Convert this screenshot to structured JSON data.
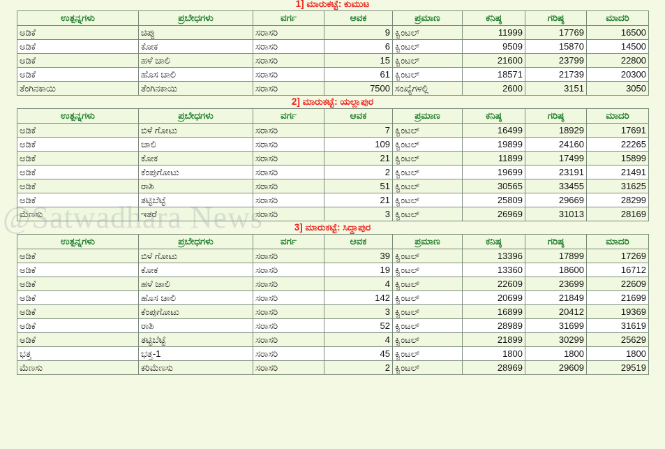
{
  "watermark": "@Satwadhara News",
  "columns": {
    "product": "ಉತ್ಪನ್ನಗಳು",
    "variety": "ಪ್ರಬೇಧಗಳು",
    "grade": "ವರ್ಗ",
    "arrival": "ಆವಕ",
    "unit": "ಪ್ರಮಾಣ",
    "min": "ಕನಿಷ್ಠ",
    "max": "ಗರಿಷ್ಠ",
    "modal": "ಮಾದರಿ"
  },
  "markets": [
    {
      "title": "1] ಮಾರುಕಟ್ಟೆ: ಕುಮುಟ",
      "rows": [
        {
          "product": "ಅಡಿಕೆ",
          "variety": "ಚಿಪ್ಪು",
          "grade": "ಸರಾಸರಿ",
          "arrival": "9",
          "unit": "ಕ್ವಿಂಟಲ್",
          "min": "11999",
          "max": "17769",
          "modal": "16500"
        },
        {
          "product": "ಅಡಿಕೆ",
          "variety": "ಕೋಕ",
          "grade": "ಸರಾಸರಿ",
          "arrival": "6",
          "unit": "ಕ್ವಿಂಟಲ್",
          "min": "9509",
          "max": "15870",
          "modal": "14500"
        },
        {
          "product": "ಅಡಿಕೆ",
          "variety": "ಹಳೆ ಚಾಲಿ",
          "grade": "ಸರಾಸರಿ",
          "arrival": "15",
          "unit": "ಕ್ವಿಂಟಲ್",
          "min": "21600",
          "max": "23799",
          "modal": "22800"
        },
        {
          "product": "ಅಡಿಕೆ",
          "variety": "ಹೊಸ ಚಾಲಿ",
          "grade": "ಸರಾಸರಿ",
          "arrival": "61",
          "unit": "ಕ್ವಿಂಟಲ್",
          "min": "18571",
          "max": "21739",
          "modal": "20300"
        },
        {
          "product": "ತೆಂಗಿನಕಾಯಿ",
          "variety": "ತೆಂಗಿನಕಾಯಿ",
          "grade": "ಸರಾಸರಿ",
          "arrival": "7500",
          "unit": "ಸಂಖ್ಯೆಗಳಲ್ಲಿ",
          "min": "2600",
          "max": "3151",
          "modal": "3050"
        }
      ]
    },
    {
      "title": "2] ಮಾರುಕಟ್ಟೆ: ಯಲ್ಲಾಪುರ",
      "rows": [
        {
          "product": "ಅಡಿಕೆ",
          "variety": "ಬಿಳೆ ಗೋಟು",
          "grade": "ಸರಾಸರಿ",
          "arrival": "7",
          "unit": "ಕ್ವಿಂಟಲ್",
          "min": "16499",
          "max": "18929",
          "modal": "17691"
        },
        {
          "product": "ಅಡಿಕೆ",
          "variety": "ಚಾಲಿ",
          "grade": "ಸರಾಸರಿ",
          "arrival": "109",
          "unit": "ಕ್ವಿಂಟಲ್",
          "min": "19899",
          "max": "24160",
          "modal": "22265"
        },
        {
          "product": "ಅಡಿಕೆ",
          "variety": "ಕೋಕ",
          "grade": "ಸರಾಸರಿ",
          "arrival": "21",
          "unit": "ಕ್ವಿಂಟಲ್",
          "min": "11899",
          "max": "17499",
          "modal": "15899"
        },
        {
          "product": "ಅಡಿಕೆ",
          "variety": "ಕೆಂಪುಗೋಟು",
          "grade": "ಸರಾಸರಿ",
          "arrival": "2",
          "unit": "ಕ್ವಿಂಟಲ್",
          "min": "19699",
          "max": "23191",
          "modal": "21491"
        },
        {
          "product": "ಅಡಿಕೆ",
          "variety": "ರಾಶಿ",
          "grade": "ಸರಾಸರಿ",
          "arrival": "51",
          "unit": "ಕ್ವಿಂಟಲ್",
          "min": "30565",
          "max": "33455",
          "modal": "31625"
        },
        {
          "product": "ಅಡಿಕೆ",
          "variety": "ತಟ್ಟಿಬೆಟ್ಟೆ",
          "grade": "ಸರಾಸರಿ",
          "arrival": "21",
          "unit": "ಕ್ವಿಂಟಲ್",
          "min": "25809",
          "max": "29669",
          "modal": "28299"
        },
        {
          "product": "ಮೆಣಸು",
          "variety": "ಇತರೆ",
          "grade": "ಸರಾಸರಿ",
          "arrival": "3",
          "unit": "ಕ್ವಿಂಟಲ್",
          "min": "26969",
          "max": "31013",
          "modal": "28169"
        }
      ]
    },
    {
      "title": "3] ಮಾರುಕಟ್ಟೆ: ಸಿದ್ದಾಪುರ",
      "rows": [
        {
          "product": "ಅಡಿಕೆ",
          "variety": "ಬಿಳೆ ಗೋಟು",
          "grade": "ಸರಾಸರಿ",
          "arrival": "39",
          "unit": "ಕ್ವಿಂಟಲ್",
          "min": "13396",
          "max": "17899",
          "modal": "17269"
        },
        {
          "product": "ಅಡಿಕೆ",
          "variety": "ಕೋಕ",
          "grade": "ಸರಾಸರಿ",
          "arrival": "19",
          "unit": "ಕ್ವಿಂಟಲ್",
          "min": "13360",
          "max": "18600",
          "modal": "16712"
        },
        {
          "product": "ಅಡಿಕೆ",
          "variety": "ಹಳೆ ಚಾಲಿ",
          "grade": "ಸರಾಸರಿ",
          "arrival": "4",
          "unit": "ಕ್ವಿಂಟಲ್",
          "min": "22609",
          "max": "23699",
          "modal": "22609"
        },
        {
          "product": "ಅಡಿಕೆ",
          "variety": "ಹೊಸ ಚಾಲಿ",
          "grade": "ಸರಾಸರಿ",
          "arrival": "142",
          "unit": "ಕ್ವಿಂಟಲ್",
          "min": "20699",
          "max": "21849",
          "modal": "21699"
        },
        {
          "product": "ಅಡಿಕೆ",
          "variety": "ಕೆಂಪುಗೋಟು",
          "grade": "ಸರಾಸರಿ",
          "arrival": "3",
          "unit": "ಕ್ವಿಂಟಲ್",
          "min": "16899",
          "max": "20412",
          "modal": "19369"
        },
        {
          "product": "ಅಡಿಕೆ",
          "variety": "ರಾಶಿ",
          "grade": "ಸರಾಸರಿ",
          "arrival": "52",
          "unit": "ಕ್ವಿಂಟಲ್",
          "min": "28989",
          "max": "31699",
          "modal": "31619"
        },
        {
          "product": "ಅಡಿಕೆ",
          "variety": "ತಟ್ಟಿಬೆಟ್ಟೆ",
          "grade": "ಸರಾಸರಿ",
          "arrival": "4",
          "unit": "ಕ್ವಿಂಟಲ್",
          "min": "21899",
          "max": "30299",
          "modal": "25629"
        },
        {
          "product": "ಭತ್ತ",
          "variety": "ಭತ್ತ-1",
          "grade": "ಸರಾಸರಿ",
          "arrival": "45",
          "unit": "ಕ್ವಿಂಟಲ್",
          "min": "1800",
          "max": "1800",
          "modal": "1800"
        },
        {
          "product": "ಮೆಣಸು",
          "variety": "ಕರಿಮೆಣಸು",
          "grade": "ಸರಾಸರಿ",
          "arrival": "2",
          "unit": "ಕ್ವಿಂಟಲ್",
          "min": "28969",
          "max": "29609",
          "modal": "29519"
        }
      ]
    }
  ]
}
